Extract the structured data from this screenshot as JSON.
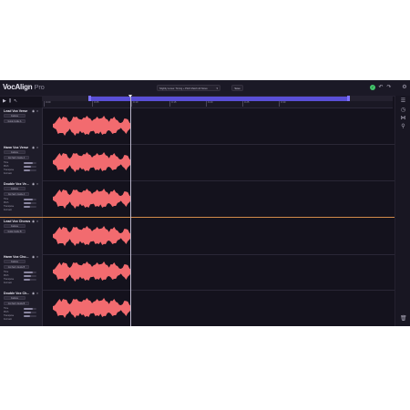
{
  "app": {
    "name": "VocAlign",
    "edition": "Pro"
  },
  "header": {
    "preset": "Slightly Loose: Timing + Pitch Match All Notes",
    "save_label": "Save",
    "icons": [
      "check-icon",
      "undo-icon",
      "redo-icon",
      "settings-icon"
    ]
  },
  "toolbar": {
    "icons": [
      "play-icon",
      "align-icon",
      "cursor-icon"
    ]
  },
  "ruler": {
    "ticks": [
      "0:00",
      "0:05",
      "0:10",
      "0:15",
      "0:20",
      "0:25",
      "0:30"
    ]
  },
  "rail": {
    "icons": [
      "list-icon",
      "clock-icon",
      "tuning-icon",
      "mix-icon",
      "trash-icon"
    ]
  },
  "labels": {
    "time": "Time",
    "pitch": "Pitch",
    "transpose": "Transpose",
    "mute": "Mute",
    "formant": "Formant"
  },
  "lanes": [
    {
      "name": "Lead Vox Verse",
      "role": "Capture",
      "preset": "Guide Guide A",
      "guide": true
    },
    {
      "name": "Harm Vox Verse",
      "role": "Capture",
      "preset": "Gst harm Guide A",
      "guide": false
    },
    {
      "name": "Double Vox Ve...",
      "role": "Capture",
      "preset": "Gst harm Guide A",
      "guide": false
    },
    {
      "name": "Lead Vox Chorus",
      "role": "Capture",
      "preset": "Guide Guide B",
      "guide": true
    },
    {
      "name": "Harm Vox Cho...",
      "role": "Capture",
      "preset": "Gst harm Guide B",
      "guide": false
    },
    {
      "name": "Double Vox Ch...",
      "role": "Capture",
      "preset": "Gst harm Guide B",
      "guide": false
    }
  ]
}
